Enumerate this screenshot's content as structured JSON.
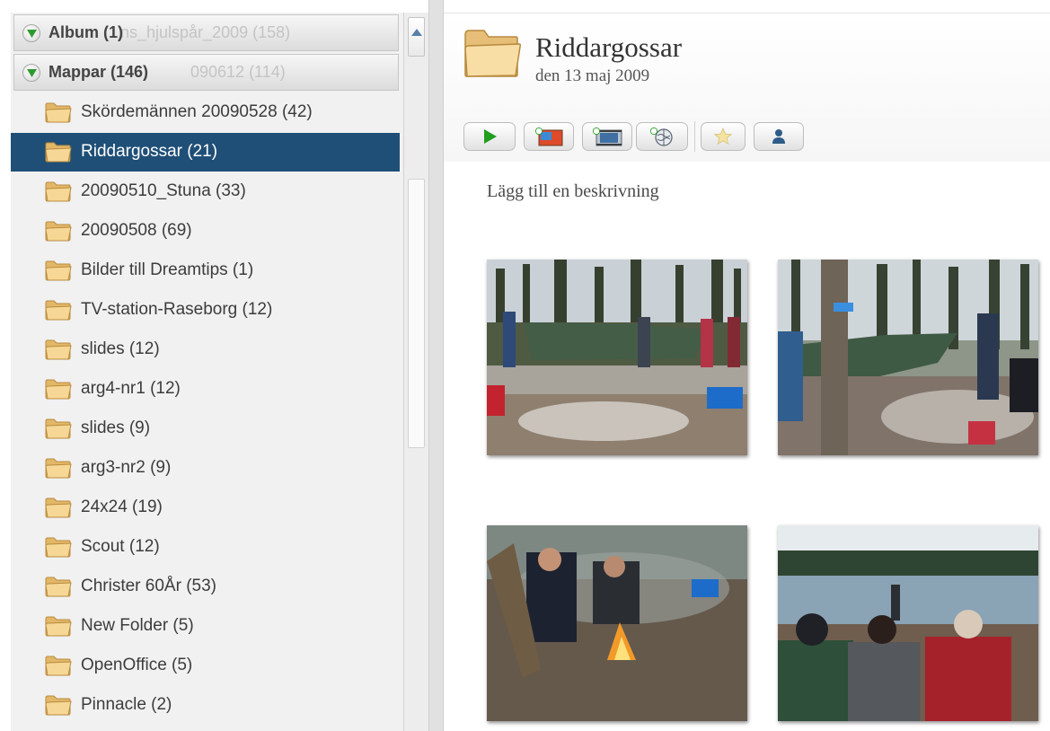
{
  "sidebar": {
    "album_header": {
      "label": "Album (1)",
      "ghost_label": "ns_hjulspår_2009 (158)"
    },
    "folders_header": {
      "label": "Mappar (146)",
      "ghost_label": "090612 (114)"
    },
    "folders": [
      {
        "label": "Skördemännen 20090528 (42)"
      },
      {
        "label": "Riddargossar (21)",
        "selected": true
      },
      {
        "label": "20090510_Stuna (33)"
      },
      {
        "label": "20090508 (69)"
      },
      {
        "label": "Bilder till Dreamtips (1)"
      },
      {
        "label": "TV-station-Raseborg (12)"
      },
      {
        "label": "slides (12)"
      },
      {
        "label": "arg4-nr1 (12)"
      },
      {
        "label": "slides (9)"
      },
      {
        "label": "arg3-nr2 (9)"
      },
      {
        "label": "24x24 (19)"
      },
      {
        "label": "Scout (12)"
      },
      {
        "label": "Christer 60År (53)"
      },
      {
        "label": "New Folder (5)"
      },
      {
        "label": "OpenOffice (5)"
      },
      {
        "label": "Pinnacle (2)"
      }
    ]
  },
  "main": {
    "title": "Riddargossar",
    "date": "den 13 maj 2009",
    "description_placeholder": "Lägg till en beskrivning",
    "toolbar_icons": [
      "play-icon",
      "add-photo-icon",
      "add-movie-icon",
      "add-web-icon",
      "star-icon",
      "person-icon"
    ]
  },
  "colors": {
    "selection": "#1f4f77",
    "folder_icon": "#f0c46a",
    "play_green": "#1f9e1f",
    "header_text": "#444444"
  }
}
